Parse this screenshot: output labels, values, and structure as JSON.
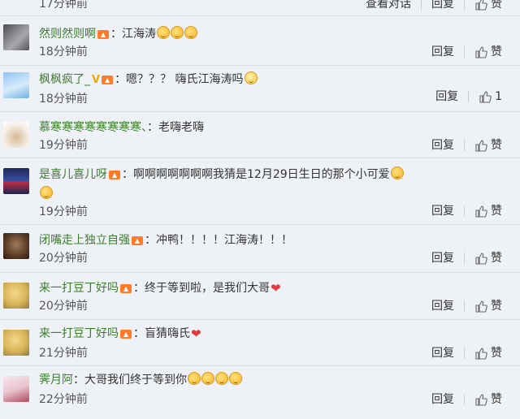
{
  "actions": {
    "reply": "回复",
    "like": "赞",
    "view_conversation": "查看对话"
  },
  "comments": [
    {
      "time": "17分钟前"
    },
    {
      "user": "然则然则啊",
      "text": "：江海涛",
      "emojis": 3,
      "time": "18分钟前"
    },
    {
      "user": "枫枫疯了_",
      "badge": "V",
      "text": "：嗯？？？ 嗨氏江海涛吗",
      "emojis": 1,
      "time": "18分钟前",
      "like_count": "1"
    },
    {
      "user": "慕寒寒寒寒寒寒寒寒、",
      "text": "：老嗨老嗨",
      "time": "19分钟前"
    },
    {
      "user": "是喜儿喜儿呀",
      "text": "：啊啊啊啊啊啊啊我猜是12月29日生日的那个小可爱",
      "time": "19分钟前"
    },
    {
      "user": "闭嘴走上独立自强",
      "text": "：冲鸭！！！！江海涛！！！",
      "time": "20分钟前"
    },
    {
      "user": "来一打豆丁好吗",
      "text": "：终于等到啦，是我们大哥",
      "time": "20分钟前"
    },
    {
      "user": "来一打豆丁好吗",
      "text": "：盲猜嗨氏",
      "time": "21分钟前"
    },
    {
      "user": "霁月阿",
      "text": "：大哥我们终于等到你",
      "emojis": 4,
      "time": "22分钟前"
    }
  ],
  "colors": {
    "username": "#3c7d2c",
    "background": "#eef1f6",
    "heart": "#e4393c",
    "vip": "#ff7b27"
  }
}
